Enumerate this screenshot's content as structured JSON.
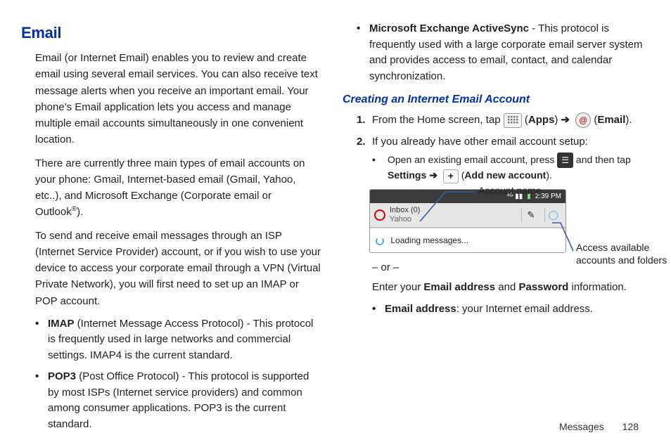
{
  "header": {
    "title": "Email"
  },
  "left": {
    "p1": "Email (or Internet Email) enables you to review and create email using several email services. You can also receive text message alerts when you receive an important email. Your phone's Email application lets you access and manage multiple email accounts simultaneously in one convenient location.",
    "p2": "There are currently three main types of email accounts on your phone: Gmail, Internet-based email (Gmail, Yahoo, etc..), and Microsoft Exchange (Corporate email or Outlook",
    "p2_sup": "®",
    "p2_end": ").",
    "p3": "To send and receive email messages through an ISP (Internet Service Provider) account, or if you wish to use your device to access your corporate email through a VPN (Virtual Private Network), you will first need to set up an IMAP or POP account.",
    "bul1_b": "IMAP",
    "bul1_t": " (Internet Message Access Protocol) - This protocol is frequently used in large networks and commercial settings. IMAP4 is the current standard.",
    "bul2_b": "POP3",
    "bul2_t": " (Post Office Protocol) - This protocol is supported by most ISPs (Internet service providers) and common among consumer applications. POP3 is the current standard."
  },
  "right": {
    "bul3_b": "Microsoft Exchange ActiveSync",
    "bul3_t": " - This protocol is frequently used with a large corporate email server system and provides access to email, contact, and calendar synchronization.",
    "sub": "Creating an Internet Email Account",
    "step1_pre": "From the Home screen, tap ",
    "step1_apps": "Apps",
    "step1_email": "Email",
    "step2": "If you already have other email account setup:",
    "sub_bul_a1": "Open an existing email account, press ",
    "sub_bul_a2": " and then tap ",
    "settings": "Settings",
    "add_new": "Add new account",
    "callout_top": "Account name",
    "callout_side": "Access available accounts and folders",
    "status_time": "2:39 PM",
    "acc_line1": "Inbox (0)",
    "acc_line2": "Yahoo",
    "loading": "Loading messages...",
    "or": "– or –",
    "enter_line_a": "Enter your ",
    "enter_b1": "Email address",
    "enter_mid": " and ",
    "enter_b2": "Password",
    "enter_line_b": " information.",
    "email_addr_b": "Email address",
    "email_addr_t": ": your Internet email address."
  },
  "footer": {
    "section": "Messages",
    "page": "128"
  }
}
